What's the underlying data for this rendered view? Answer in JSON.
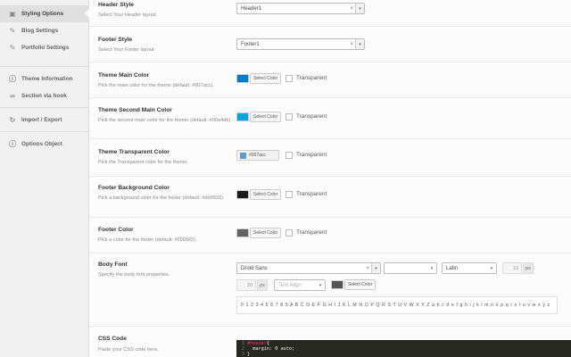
{
  "sidebar": {
    "items": [
      {
        "label": "Styling Options",
        "icon": "palette-icon",
        "active": true
      },
      {
        "label": "Blog Settings",
        "icon": "edit-icon"
      },
      {
        "label": "Portfolio Settings",
        "icon": "edit-icon"
      },
      {
        "label": "Theme Information",
        "icon": "info-icon"
      },
      {
        "label": "Section via hook",
        "icon": "link-icon"
      },
      {
        "label": "Import / Export",
        "icon": "refresh-icon"
      },
      {
        "label": "Options Object",
        "icon": "info-icon"
      }
    ]
  },
  "fields": {
    "header_style": {
      "title": "Header Style",
      "desc": "Select Your Header layout",
      "value": "Header1",
      "clear": "×",
      "arrow": "▾"
    },
    "footer_style": {
      "title": "Footer Style",
      "desc": "Select Your Footer layout",
      "value": "Footer1",
      "clear": "×",
      "arrow": "▾"
    },
    "main_color": {
      "title": "Theme Main Color",
      "desc": "Pick the main color for the theme (default: #007acc).",
      "button": "Select Color",
      "transparent": "Transparent",
      "color": "#007acc"
    },
    "second_color": {
      "title": "Theme Second Main Color",
      "desc": "Pick the second main color for the theme (default: #00a4db).",
      "button": "Select Color",
      "transparent": "Transparent",
      "color": "#00a4db"
    },
    "transparent_color": {
      "title": "Theme Transparent Color",
      "desc": "Pick the Transparent color for the theme.",
      "value": "#007acc",
      "transparent": "Transparent",
      "color": "#5b9bd5"
    },
    "footer_bg": {
      "title": "Footer Background Color",
      "desc": "Pick a background color for the footer (default: #dd9933).",
      "button": "Select Color",
      "transparent": "Transparent",
      "color": "#1a1a1a"
    },
    "footer_color": {
      "title": "Footer Color",
      "desc": "Pick a color for the footer (default: #656565).",
      "button": "Select Color",
      "transparent": "Transparent",
      "color": "#656565"
    },
    "body_font": {
      "title": "Body Font",
      "desc": "Specify the body font properties.",
      "family": "Droid Sans",
      "clear": "×",
      "arrow": "▾",
      "style": "",
      "subset": "Latin",
      "size": "13",
      "size_unit": "px",
      "line_height": "20",
      "lh_unit": "px",
      "align": "Text Align",
      "button": "Select Color",
      "color": "#555555",
      "preview": "0 1 2 3 4 5 6 7 8 9 A B C D E F G H I J K L M N O P Q R S T U V W X Y Z a b c d e f g h i j k l m n o p q r s t u v w x y z"
    },
    "css_code": {
      "title": "CSS Code",
      "desc": "Paste your CSS code here.",
      "lines": [
        {
          "n": "1",
          "sel": "#header",
          "rest": "{"
        },
        {
          "n": "2",
          "sel": "",
          "rest": "  margin: 0 auto;"
        },
        {
          "n": "3",
          "sel": "",
          "rest": "}"
        }
      ]
    }
  }
}
